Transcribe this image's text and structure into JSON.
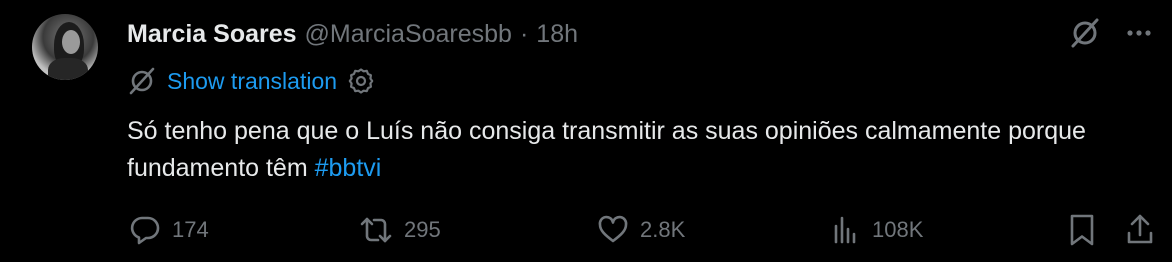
{
  "tweet": {
    "author_name": "Marcia Soares",
    "handle": "@MarciaSoaresbb",
    "separator": "·",
    "time": "18h",
    "translation_label": "Show translation",
    "text_main": "Só tenho pena que o Luís não consiga transmitir as suas opiniões calmamente porque fundamento têm ",
    "hashtag": "#bbtvi"
  },
  "actions": {
    "replies": "174",
    "reposts": "295",
    "likes": "2.8K",
    "views": "108K"
  },
  "icons": {
    "translate": "translate-icon",
    "settings": "gear-icon",
    "grok": "grok-icon",
    "more": "more-icon",
    "reply": "reply-icon",
    "repost": "repost-icon",
    "like": "heart-icon",
    "views": "views-icon",
    "bookmark": "bookmark-icon",
    "share": "share-icon"
  },
  "colors": {
    "background": "#000000",
    "text": "#e7e9ea",
    "muted": "#71767b",
    "accent": "#1d9bf0"
  }
}
